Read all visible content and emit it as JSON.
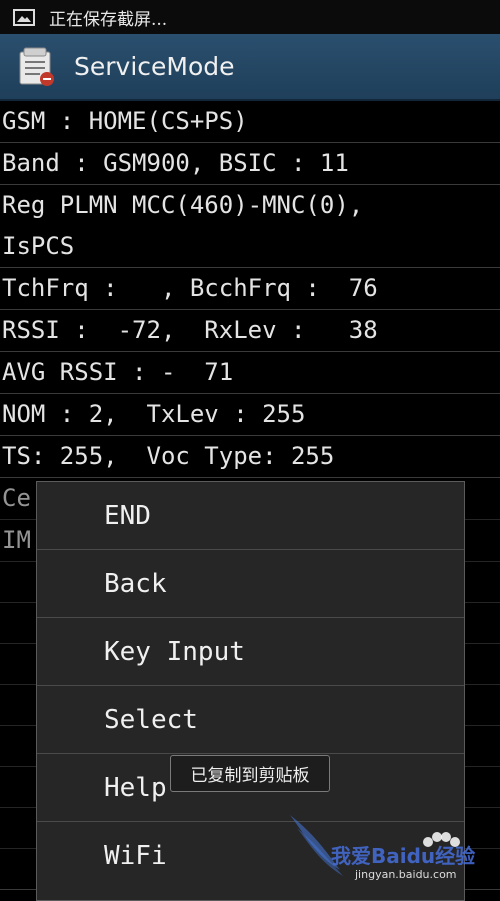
{
  "status_bar": {
    "icon": "image-icon",
    "text": "正在保存截屏..."
  },
  "app": {
    "icon": "service-mode-icon",
    "title": "ServiceMode"
  },
  "rows": [
    "GSM : HOME(CS+PS)",
    "Band : GSM900, BSIC : 11",
    "Reg PLMN MCC(460)-MNC(0),",
    "IsPCS",
    "TchFrq :   , BcchFrq :  76",
    "RSSI :  -72,  RxLev :   38",
    "AVG RSSI : -  71",
    "NOM : 2,  TxLev : 255",
    "TS: 255,  Voc Type: 255",
    "Ce",
    "IM"
  ],
  "menu": {
    "items": [
      "END",
      "Back",
      "Key Input",
      "Select",
      "Help",
      "WiFi"
    ]
  },
  "toast": {
    "text": "已复制到剪贴板"
  },
  "watermark": {
    "text": "我爱Baidu经验",
    "url": "jingyan.baidu.com"
  }
}
